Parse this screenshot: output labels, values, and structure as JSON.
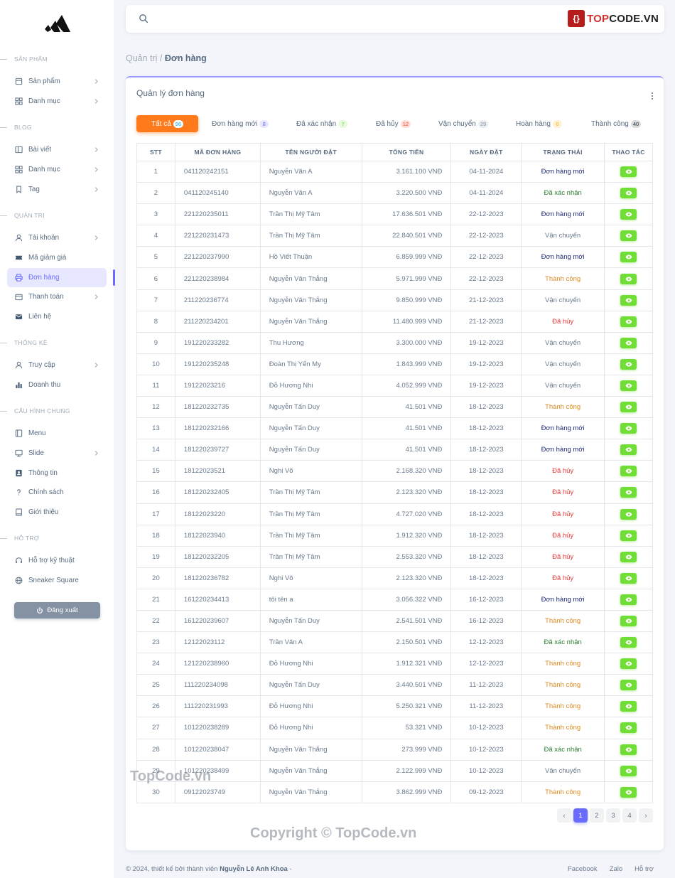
{
  "sidebar": {
    "sections": [
      {
        "title": "SẢN PHẨM",
        "items": [
          {
            "label": "Sản phẩm",
            "icon": "box-icon",
            "chevron": true
          },
          {
            "label": "Danh mục",
            "icon": "grid-icon",
            "chevron": true
          }
        ]
      },
      {
        "title": "BLOG",
        "items": [
          {
            "label": "Bài viết",
            "icon": "layout-icon",
            "chevron": true
          },
          {
            "label": "Danh mục",
            "icon": "grid-icon",
            "chevron": true
          },
          {
            "label": "Tag",
            "icon": "bookmark-icon",
            "chevron": true
          }
        ]
      },
      {
        "title": "QUẢN TRỊ",
        "items": [
          {
            "label": "Tài khoản",
            "icon": "user-icon",
            "chevron": true
          },
          {
            "label": "Mã giảm giá",
            "icon": "ticket-icon",
            "chevron": false
          },
          {
            "label": "Đơn hàng",
            "icon": "printer-icon",
            "chevron": false,
            "active": true
          },
          {
            "label": "Thanh toán",
            "icon": "wallet-icon",
            "chevron": true
          },
          {
            "label": "Liên hệ",
            "icon": "mail-icon",
            "chevron": false
          }
        ]
      },
      {
        "title": "THỐNG KÊ",
        "items": [
          {
            "label": "Truy cập",
            "icon": "user-icon",
            "chevron": true
          },
          {
            "label": "Doanh thu",
            "icon": "bar-chart-icon",
            "chevron": false
          }
        ]
      },
      {
        "title": "CẤU HÌNH CHUNG",
        "items": [
          {
            "label": "Menu",
            "icon": "menu-book-icon",
            "chevron": false
          },
          {
            "label": "Slide",
            "icon": "monitor-icon",
            "chevron": true
          },
          {
            "label": "Thông tin",
            "icon": "contact-card-icon",
            "chevron": false
          },
          {
            "label": "Chính sách",
            "icon": "question-icon",
            "chevron": false
          },
          {
            "label": "Giới thiệu",
            "icon": "book-icon",
            "chevron": false
          }
        ]
      },
      {
        "title": "HỖ TRỢ",
        "items": [
          {
            "label": "Hỗ trợ kỹ thuật",
            "icon": "headset-icon",
            "chevron": false
          },
          {
            "label": "Sneaker Square",
            "icon": "globe-icon",
            "chevron": false
          }
        ]
      }
    ],
    "logout_label": "Đăng xuất"
  },
  "topbar": {
    "search_placeholder": "",
    "brand_prefix": "TOP",
    "brand_suffix": "CODE.VN"
  },
  "breadcrumb": {
    "parent": "Quản trị /",
    "current": "Đơn hàng"
  },
  "card": {
    "title": "Quản lý đơn hàng"
  },
  "tabs": [
    {
      "label": "Tất cả",
      "count": "96",
      "active": true,
      "badge_bg": "#e7f1ff",
      "badge_color": "#03a9f4"
    },
    {
      "label": "Đơn hàng mới",
      "count": "8",
      "badge_bg": "#e7e7ff",
      "badge_color": "#696cff"
    },
    {
      "label": "Đã xác nhận",
      "count": "7",
      "badge_bg": "#e8fadf",
      "badge_color": "#71dd37"
    },
    {
      "label": "Đã hủy",
      "count": "12",
      "badge_bg": "#ffe0db",
      "badge_color": "#ff3e1d"
    },
    {
      "label": "Vận chuyển",
      "count": "29",
      "badge_bg": "#ebeef0",
      "badge_color": "#8592a3"
    },
    {
      "label": "Hoàn hàng",
      "count": "0",
      "badge_bg": "#fff2d6",
      "badge_color": "#ffab00"
    },
    {
      "label": "Thành công",
      "count": "40",
      "badge_bg": "#dcdcdc",
      "badge_color": "#233446"
    }
  ],
  "table": {
    "columns": [
      "STT",
      "MÃ ĐƠN HÀNG",
      "TÊN NGƯỜI ĐẶT",
      "TỔNG TIỀN",
      "NGÀY ĐẶT",
      "TRẠNG THÁI",
      "THAO TÁC"
    ],
    "status_colors": {
      "Đơn hàng mới": "#1e2a78",
      "Đã xác nhận": "#2e7d32",
      "Vận chuyển": "#697a8d",
      "Thành công": "#e08a1e",
      "Đã hủy": "#e53935"
    },
    "rows": [
      [
        "1",
        "041120242151",
        "Nguyễn Văn A",
        "3.161.100 VNĐ",
        "04-11-2024",
        "Đơn hàng mới"
      ],
      [
        "2",
        "041120245140",
        "Nguyễn Văn A",
        "3.220.500 VNĐ",
        "04-11-2024",
        "Đã xác nhận"
      ],
      [
        "3",
        "221220235011",
        "Trần Thị Mỹ Tâm",
        "17.636.501 VNĐ",
        "22-12-2023",
        "Đơn hàng mới"
      ],
      [
        "4",
        "221220231473",
        "Trần Thị Mỹ Tâm",
        "22.840.501 VNĐ",
        "22-12-2023",
        "Vận chuyển"
      ],
      [
        "5",
        "221220237990",
        "Hồ Viết Thuận",
        "6.859.999 VNĐ",
        "22-12-2023",
        "Đơn hàng mới"
      ],
      [
        "6",
        "221220238984",
        "Nguyễn Văn Thắng",
        "5.971.999 VNĐ",
        "22-12-2023",
        "Thành công"
      ],
      [
        "7",
        "211220236774",
        "Nguyễn Văn Thắng",
        "9.850.999 VNĐ",
        "21-12-2023",
        "Vận chuyển"
      ],
      [
        "8",
        "211220234201",
        "Nguyễn Văn Thắng",
        "11.480.999 VNĐ",
        "21-12-2023",
        "Đã hủy"
      ],
      [
        "9",
        "191220233282",
        "Thu Hương",
        "3.300.000 VNĐ",
        "19-12-2023",
        "Vận chuyển"
      ],
      [
        "10",
        "191220235248",
        "Đoàn Thị Yến My",
        "1.843.999 VNĐ",
        "19-12-2023",
        "Vận chuyển"
      ],
      [
        "11",
        "19122023216",
        "Đỗ Hương Nhi",
        "4.052.999 VNĐ",
        "19-12-2023",
        "Vận chuyển"
      ],
      [
        "12",
        "181220232735",
        "Nguyễn Tấn Duy",
        "41.501 VNĐ",
        "18-12-2023",
        "Thành công"
      ],
      [
        "13",
        "181220232166",
        "Nguyễn Tấn Duy",
        "41.501 VNĐ",
        "18-12-2023",
        "Đơn hàng mới"
      ],
      [
        "14",
        "181220239727",
        "Nguyễn Tấn Duy",
        "41.501 VNĐ",
        "18-12-2023",
        "Đơn hàng mới"
      ],
      [
        "15",
        "18122023521",
        "Nghi Võ",
        "2.168.320 VNĐ",
        "18-12-2023",
        "Đã hủy"
      ],
      [
        "16",
        "181220232405",
        "Trần Thị Mỹ Tâm",
        "2.123.320 VNĐ",
        "18-12-2023",
        "Đã hủy"
      ],
      [
        "17",
        "18122023220",
        "Trần Thị Mỹ Tâm",
        "4.727.020 VNĐ",
        "18-12-2023",
        "Đã hủy"
      ],
      [
        "18",
        "18122023940",
        "Trần Thị Mỹ Tâm",
        "1.912.320 VNĐ",
        "18-12-2023",
        "Đã hủy"
      ],
      [
        "19",
        "181220232205",
        "Trần Thị Mỹ Tâm",
        "2.553.320 VNĐ",
        "18-12-2023",
        "Đã hủy"
      ],
      [
        "20",
        "181220236782",
        "Nghi Võ",
        "2.123.320 VNĐ",
        "18-12-2023",
        "Đã hủy"
      ],
      [
        "21",
        "161220234413",
        "tôi tên a",
        "3.056.322 VNĐ",
        "16-12-2023",
        "Đơn hàng mới"
      ],
      [
        "22",
        "161220239607",
        "Nguyễn Tấn Duy",
        "2.541.501 VNĐ",
        "16-12-2023",
        "Thành công"
      ],
      [
        "23",
        "12122023112",
        "Trần Văn A",
        "2.150.501 VNĐ",
        "12-12-2023",
        "Đã xác nhận"
      ],
      [
        "24",
        "121220238960",
        "Đỗ Hương Nhi",
        "1.912.321 VNĐ",
        "12-12-2023",
        "Thành công"
      ],
      [
        "25",
        "111220234098",
        "Nguyễn Tấn Duy",
        "3.440.501 VNĐ",
        "11-12-2023",
        "Thành công"
      ],
      [
        "26",
        "111220231993",
        "Đỗ Hương Nhi",
        "5.250.321 VNĐ",
        "11-12-2023",
        "Thành công"
      ],
      [
        "27",
        "101220238289",
        "Đỗ Hương Nhi",
        "53.321 VNĐ",
        "10-12-2023",
        "Thành công"
      ],
      [
        "28",
        "101220238047",
        "Nguyễn Văn Thắng",
        "273.999 VNĐ",
        "10-12-2023",
        "Đã xác nhận"
      ],
      [
        "29",
        "101220238499",
        "Nguyễn Văn Thắng",
        "2.122.999 VNĐ",
        "10-12-2023",
        "Vận chuyển"
      ],
      [
        "30",
        "09122023749",
        "Nguyễn Văn Thắng",
        "3.862.999 VNĐ",
        "09-12-2023",
        "Thành công"
      ]
    ]
  },
  "pagination": {
    "prev": "‹",
    "pages": [
      "1",
      "2",
      "3",
      "4"
    ],
    "current": "1",
    "next": "›"
  },
  "footer": {
    "left_prefix": "© 2024, thiết kế bởi thành viên",
    "author": "Nguyễn Lê Anh Khoa",
    "left_suffix": "-",
    "links": [
      "Facebook",
      "Zalo",
      "Hỗ trợ"
    ]
  },
  "watermarks": {
    "top_left": "TopCode.vn",
    "copyright": "Copyright © TopCode.vn"
  },
  "colors": {
    "accent": "#696cff",
    "active_tab": "#ff7a1a",
    "view_button": "#71dd37"
  }
}
